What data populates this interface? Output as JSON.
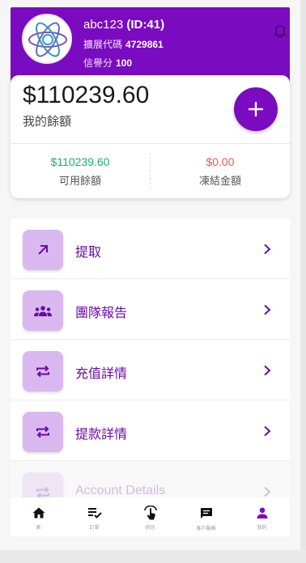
{
  "profile": {
    "username": "abc123",
    "id_text": "(ID:41)",
    "referral_label": "擴展代碼",
    "referral_code": "4729861",
    "credit_label": "信譽分",
    "credit_score": "100"
  },
  "balance": {
    "amount": "$110239.60",
    "label": "我的餘額",
    "available_value": "$110239.60",
    "available_label": "可用餘額",
    "frozen_value": "$0.00",
    "frozen_label": "凍結金額"
  },
  "menu": [
    {
      "label": "提取",
      "icon": "arrow-up-right-icon"
    },
    {
      "label": "團隊報告",
      "icon": "group-icon"
    },
    {
      "label": "充值詳情",
      "icon": "repeat-icon"
    },
    {
      "label": "提款詳情",
      "icon": "repeat-icon"
    },
    {
      "label": "Account Details",
      "icon": "repeat-icon"
    }
  ],
  "tabs": [
    {
      "label": "家",
      "icon": "home-icon"
    },
    {
      "label": "訂單",
      "icon": "order-list-icon"
    },
    {
      "label": "抓住",
      "icon": "tap-icon"
    },
    {
      "label": "客戶服務",
      "icon": "chat-icon"
    },
    {
      "label": "我的",
      "icon": "person-icon"
    }
  ],
  "colors": {
    "primary": "#7a0bc0",
    "icon_bg": "#d9b8ef",
    "available": "#18b06a",
    "frozen": "#f0584f",
    "active_tab": "#7a0bc0",
    "inactive_tab": "#111111"
  }
}
